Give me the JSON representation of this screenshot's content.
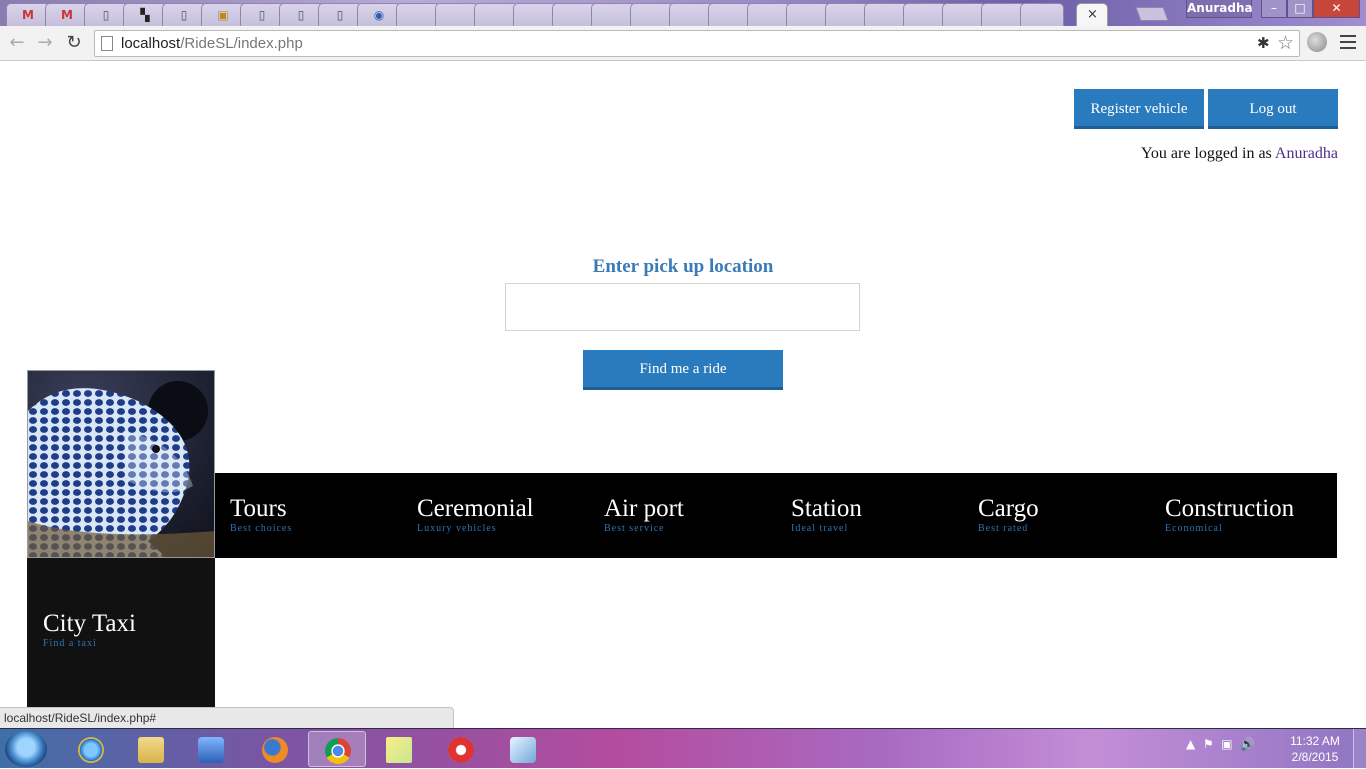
{
  "browser": {
    "profile_name": "Anuradha",
    "url_host": "localhost",
    "url_path": "/RideSL/index.php",
    "status_url": "localhost/RideSL/index.php#",
    "window_controls": {
      "minimize": "–",
      "maximize": "□",
      "close": "✕"
    },
    "active_tab_close": "×"
  },
  "header": {
    "register_label": "Register vehicle",
    "logout_label": "Log out",
    "logged_in_prefix": "You are logged in as",
    "username": "Anuradha"
  },
  "search": {
    "label": "Enter pick up location",
    "value": "",
    "button_label": "Find me a ride"
  },
  "categories": [
    {
      "title": "Tours",
      "subtitle": "Best choices"
    },
    {
      "title": "Ceremonial",
      "subtitle": "Luxury vehicles"
    },
    {
      "title": "Air port",
      "subtitle": "Best service"
    },
    {
      "title": "Station",
      "subtitle": "Ideal travel"
    },
    {
      "title": "Cargo",
      "subtitle": "Best rated"
    },
    {
      "title": "Construction",
      "subtitle": "Economical"
    }
  ],
  "city_taxi": {
    "title": "City Taxi",
    "subtitle": "Find a taxi"
  },
  "taskbar": {
    "time": "11:32 AM",
    "date": "2/8/2015"
  },
  "colors": {
    "button_blue": "#2a7bbd",
    "label_blue": "#3b7ab8",
    "username_purple": "#4b2f8c",
    "bar_black": "#000000"
  }
}
